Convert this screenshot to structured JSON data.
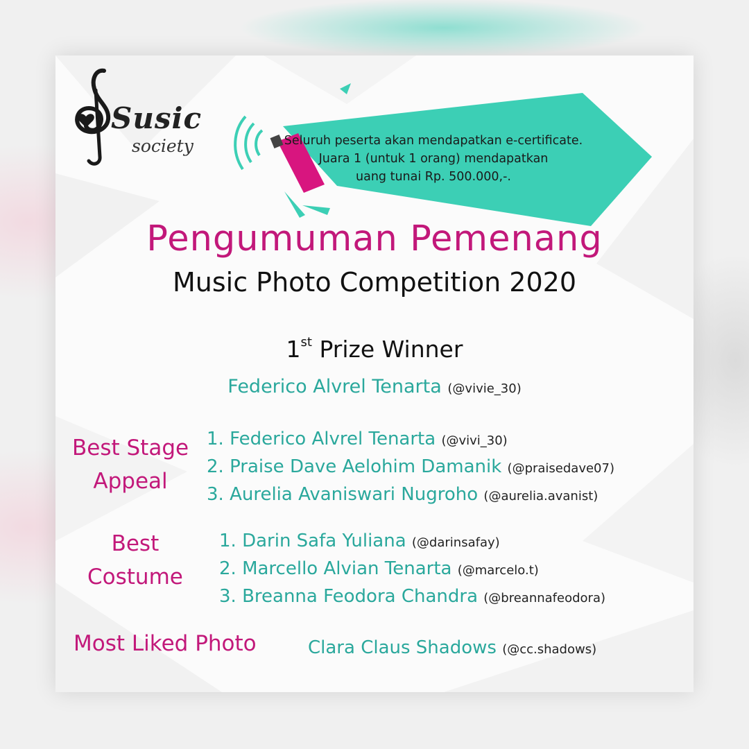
{
  "logo": {
    "word": "Susic",
    "sub": "society"
  },
  "banner": {
    "lines": [
      "Seluruh peserta akan mendapatkan e-certificate.",
      "Juara 1 (untuk 1 orang) mendapatkan",
      "uang tunai Rp. 500.000,-."
    ]
  },
  "title": "Pengumuman Pemenang",
  "subtitle": "Music Photo Competition 2020",
  "first_prize": {
    "heading_num": "1",
    "heading_sup": "st",
    "heading_rest": "Prize Winner",
    "name": "Federico Alvrel Tenarta",
    "handle": "(@vivie_30)"
  },
  "best_stage": {
    "label_1": "Best Stage",
    "label_2": "Appeal",
    "entries": [
      {
        "name": "1. Federico Alvrel Tenarta",
        "handle": "(@vivi_30)"
      },
      {
        "name": "2. Praise Dave Aelohim Damanik",
        "handle": "(@praisedave07)"
      },
      {
        "name": "3. Aurelia Avaniswari Nugroho",
        "handle": "(@aurelia.avanist)"
      }
    ]
  },
  "best_costume": {
    "label_1": "Best",
    "label_2": "Costume",
    "entries": [
      {
        "name": "1. Darin Safa Yuliana",
        "handle": "(@darinsafay)"
      },
      {
        "name": "2. Marcello Alvian Tenarta",
        "handle": "(@marcelo.t)"
      },
      {
        "name": "3. Breanna Feodora Chandra",
        "handle": "(@breannafeodora)"
      }
    ]
  },
  "most_liked": {
    "label": "Most Liked Photo",
    "name": "Clara Claus Shadows",
    "handle": "(@cc.shadows)"
  },
  "colors": {
    "magenta": "#c2187a",
    "teal": "#2aa89c",
    "banner": "#3ccfb5"
  }
}
